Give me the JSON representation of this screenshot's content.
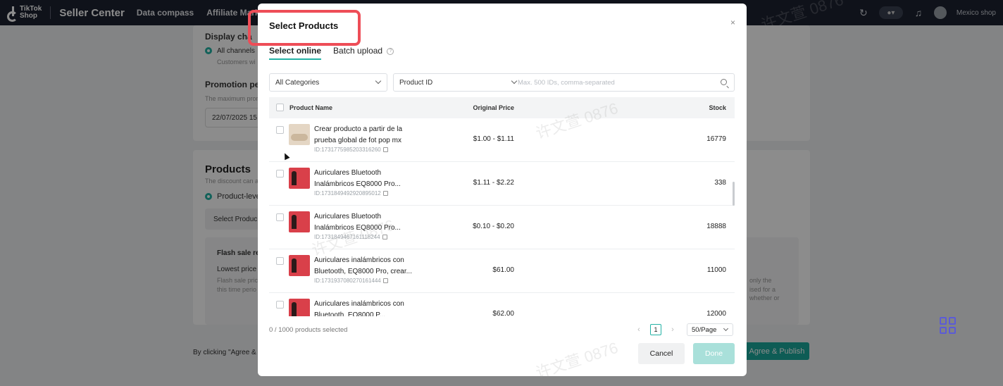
{
  "topnav": {
    "brand_line1": "TikTok",
    "brand_line2": "Shop",
    "title": "Seller Center",
    "links": [
      "Data compass",
      "Affiliate Marke"
    ],
    "shop_name": "Mexico shop"
  },
  "background": {
    "display_channels_label": "Display cha",
    "all_channels": "All channels",
    "customers_note": "Customers wi",
    "promotion_period_label": "Promotion per",
    "promotion_note": "The maximum prom",
    "start_date": "22/07/2025 15",
    "products_heading": "Products",
    "products_note": "The discount can a",
    "product_level": "Product-leve",
    "select_products_btn": "Select Produc",
    "flash_sale_label": "Flash sale re",
    "lowest_price": "Lowest price",
    "flash_note1": "Flash sale pric",
    "flash_note2": "this time perio",
    "right_note1": "only the",
    "right_note2": "ised for a",
    "right_note3": "whether or",
    "agree_text": "By clicking \"Agree &",
    "agree_button": "Agree & Publish"
  },
  "modal": {
    "title": "Select Products",
    "tabs": [
      {
        "label": "Select online"
      },
      {
        "label": "Batch upload"
      }
    ],
    "help_icon": "?",
    "category_select": "All Categories",
    "id_select": "Product ID",
    "search_placeholder": "Max. 500 IDs, comma-separated",
    "columns": {
      "name": "Product Name",
      "price": "Original Price",
      "stock": "Stock"
    },
    "products": [
      {
        "name": "Crear producto a partir de la prueba global de fot pop mx",
        "id": "ID:1731775985203316260",
        "price": "$1.00 - $1.11",
        "stock": "16779",
        "thumb": "beige"
      },
      {
        "name": "Auriculares Bluetooth Inalámbricos EQ8000 Pro...",
        "id": "ID:1731849492920895012",
        "price": "$1.11 - $2.22",
        "stock": "338",
        "thumb": "red"
      },
      {
        "name": "Auriculares Bluetooth Inalámbricos EQ8000 Pro...",
        "id": "ID:1731849467161118244",
        "price": "$0.10 - $0.20",
        "stock": "18888",
        "thumb": "red"
      },
      {
        "name": "Auriculares inalámbricos con Bluetooth, EQ8000 Pro, crear...",
        "id": "ID:1731937080270161444",
        "price": "$61.00",
        "stock": "11000",
        "thumb": "red"
      },
      {
        "name": "Auriculares inalámbricos con Bluetooth, EQ8000 P...",
        "id": "",
        "price": "$62.00",
        "stock": "12000",
        "thumb": "red"
      }
    ],
    "selected_count": "0 / 1000 products selected",
    "page": "1",
    "per_page": "50/Page",
    "cancel": "Cancel",
    "done": "Done",
    "close_symbol": "×"
  },
  "watermark": "许文萱 0876"
}
